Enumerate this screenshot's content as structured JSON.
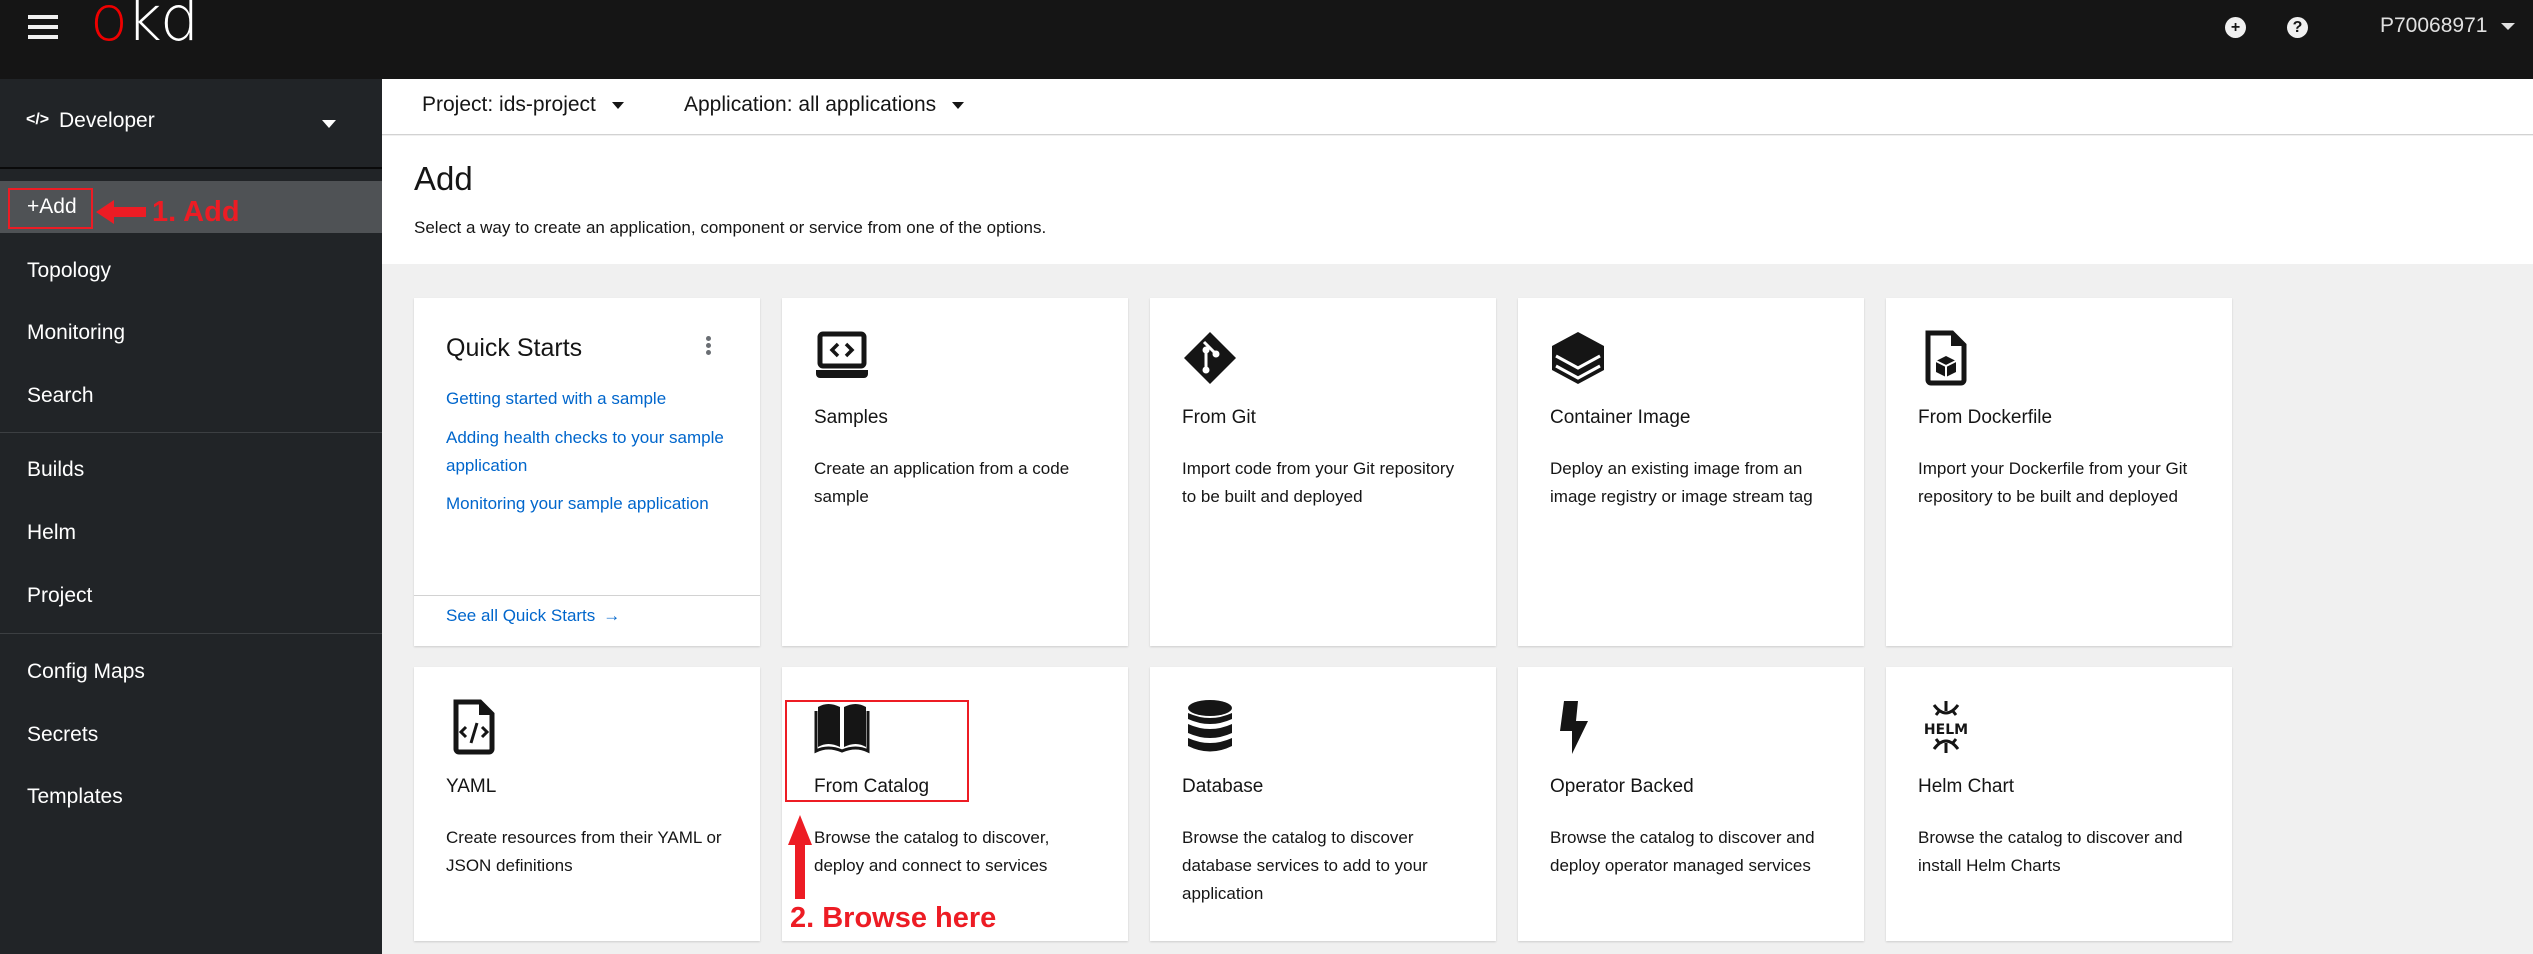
{
  "masthead": {
    "logo_o": "o",
    "logo_kd": "kd",
    "add_icon": "plus-circle-icon",
    "help_icon": "question-circle-icon",
    "user": "P70068971"
  },
  "sidebar": {
    "perspective": {
      "icon": "code-icon",
      "label": "Developer"
    },
    "items": [
      {
        "label": "+Add",
        "active": true
      },
      {
        "label": "Topology"
      },
      {
        "label": "Monitoring"
      },
      {
        "label": "Search"
      },
      {
        "label": "Builds"
      },
      {
        "label": "Helm"
      },
      {
        "label": "Project"
      },
      {
        "label": "Config Maps"
      },
      {
        "label": "Secrets"
      },
      {
        "label": "Templates"
      }
    ]
  },
  "context": {
    "project": "Project: ids-project",
    "application": "Application: all applications"
  },
  "page": {
    "title": "Add",
    "description": "Select a way to create an application, component or service from one of the options."
  },
  "quick_starts": {
    "title": "Quick Starts",
    "links": [
      "Getting started with a sample",
      "Adding health checks to your sample application",
      "Monitoring your sample application"
    ],
    "see_all": "See all Quick Starts"
  },
  "cards": [
    {
      "icon": "laptop-code-icon",
      "title": "Samples",
      "description": "Create an application from a code sample"
    },
    {
      "icon": "git-icon",
      "title": "From Git",
      "description": "Import code from your Git repository to be built and deployed"
    },
    {
      "icon": "layers-icon",
      "title": "Container Image",
      "description": "Deploy an existing image from an image registry or image stream tag"
    },
    {
      "icon": "dockerfile-icon",
      "title": "From Dockerfile",
      "description": "Import your Dockerfile from your Git repository to be built and deployed"
    },
    {
      "icon": "yaml-file-icon",
      "title": "YAML",
      "description": "Create resources from their YAML or JSON definitions"
    },
    {
      "icon": "book-open-icon",
      "title": "From Catalog",
      "description": "Browse the catalog to discover, deploy and connect to services"
    },
    {
      "icon": "database-icon",
      "title": "Database",
      "description": "Browse the catalog to discover database services to add to your application"
    },
    {
      "icon": "bolt-icon",
      "title": "Operator Backed",
      "description": "Browse the catalog to discover and deploy operator managed services"
    },
    {
      "icon": "helm-icon",
      "title": "Helm Chart",
      "description": "Browse the catalog to discover and install Helm Charts"
    }
  ],
  "annotations": {
    "step1": "1. Add",
    "step2": "2. Browse here",
    "color": "#ed1c24"
  }
}
